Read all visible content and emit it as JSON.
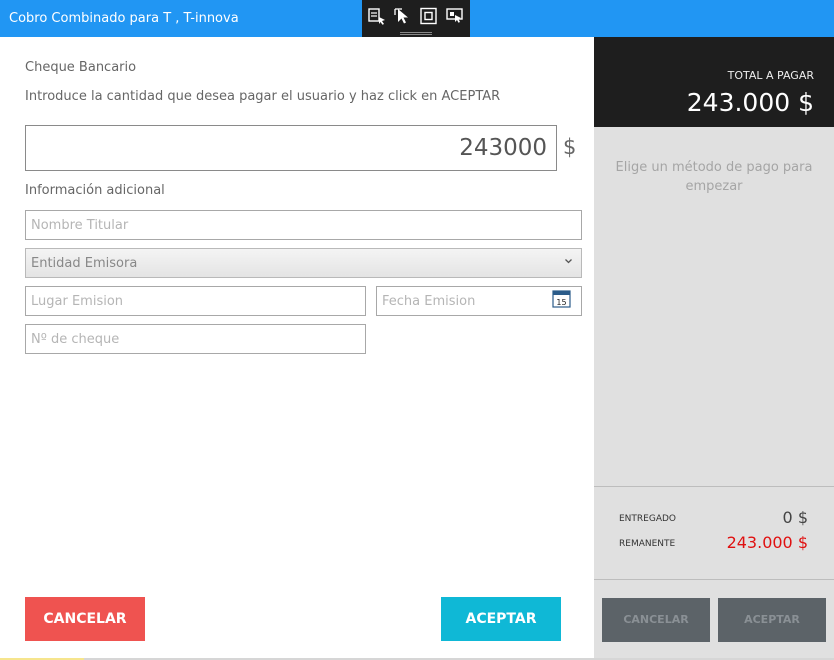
{
  "window": {
    "title": "Cobro Combinado para T , T-innova"
  },
  "devtools": {
    "icons": [
      "select-element-icon",
      "pointer-icon",
      "layout-bounds-icon",
      "track-focus-icon"
    ]
  },
  "form": {
    "section_title": "Cheque Bancario",
    "instructions": "Introduce la cantidad que desea pagar el usuario y haz click en ACEPTAR",
    "amount_value": "243000",
    "currency": "$",
    "extra_label": "Información adicional",
    "fields": {
      "nombre_titular": "Nombre Titular",
      "entidad_emisora": "Entidad Emisora",
      "lugar_emision": "Lugar Emision",
      "fecha_emision": "Fecha Emision",
      "numero_cheque": "Nº de cheque"
    },
    "calendar_day": "15",
    "buttons": {
      "cancel": "CANCELAR",
      "accept": "ACEPTAR"
    }
  },
  "summary": {
    "total_label": "TOTAL A PAGAR",
    "total_value": "243.000 $",
    "hint": "Elige un método de pago para empezar",
    "entregado_label": "ENTREGADO",
    "entregado_value": "0 $",
    "remanente_label": "REMANENTE",
    "remanente_value": "243.000 $",
    "buttons": {
      "cancel": "CANCELAR",
      "accept": "ACEPTAR"
    }
  },
  "colors": {
    "titlebar": "#2196f3",
    "cancel": "#ef5350",
    "accept": "#0fb8d6",
    "remanente": "#e01010",
    "panel_dark": "#1e1e1e"
  }
}
